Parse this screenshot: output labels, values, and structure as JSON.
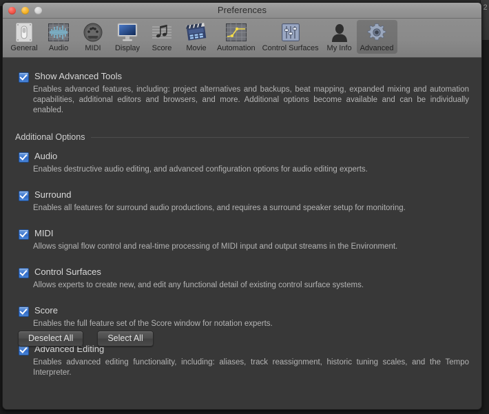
{
  "background": {
    "right_window_label": "2"
  },
  "window": {
    "title": "Preferences",
    "traffic_lights": [
      {
        "name": "close-button",
        "color": "#f45b4f"
      },
      {
        "name": "minimize-button",
        "color": "#f7b731"
      },
      {
        "name": "zoom-button",
        "color": "#d2d2d2"
      }
    ]
  },
  "toolbar": {
    "items": [
      {
        "label": "General",
        "icon": "toggle-switch-icon",
        "selected": false
      },
      {
        "label": "Audio",
        "icon": "waveform-icon",
        "selected": false
      },
      {
        "label": "MIDI",
        "icon": "midi-port-icon",
        "selected": false
      },
      {
        "label": "Display",
        "icon": "monitor-icon",
        "selected": false
      },
      {
        "label": "Score",
        "icon": "music-notes-icon",
        "selected": false
      },
      {
        "label": "Movie",
        "icon": "clapperboard-icon",
        "selected": false
      },
      {
        "label": "Automation",
        "icon": "automation-curve-icon",
        "selected": false
      },
      {
        "label": "Control Surfaces",
        "icon": "faders-icon",
        "selected": false
      },
      {
        "label": "My Info",
        "icon": "person-icon",
        "selected": false
      },
      {
        "label": "Advanced",
        "icon": "gear-icon",
        "selected": true
      }
    ]
  },
  "main": {
    "show_advanced_tools": {
      "label": "Show Advanced Tools",
      "checked": true,
      "description": "Enables advanced features, including: project alternatives and backups, beat mapping, expanded mixing and automation capabilities, additional editors and browsers, and more. Additional options become available and can be individually enabled."
    },
    "section_title": "Additional Options",
    "options": [
      {
        "label": "Audio",
        "checked": true,
        "description": "Enables destructive audio editing, and advanced configuration options for audio editing experts."
      },
      {
        "label": "Surround",
        "checked": true,
        "description": "Enables all features for surround audio productions, and requires a surround speaker setup for monitoring."
      },
      {
        "label": "MIDI",
        "checked": true,
        "description": "Allows signal flow control and real-time processing of MIDI input and output streams in the Environment."
      },
      {
        "label": "Control Surfaces",
        "checked": true,
        "description": "Allows experts to create new, and edit any functional detail of existing control surface systems."
      },
      {
        "label": "Score",
        "checked": true,
        "description": "Enables the full feature set of the Score window for notation experts."
      },
      {
        "label": "Advanced Editing",
        "checked": true,
        "description": "Enables advanced editing functionality, including: aliases, track reassignment, historic tuning scales, and the Tempo Interpreter."
      }
    ],
    "buttons": {
      "deselect_all": "Deselect All",
      "select_all": "Select All"
    }
  },
  "colors": {
    "window_background": "#383838",
    "titlebar": "#949494",
    "toolbar": "#8a8a8a",
    "checkbox_accent": "#3f78cf",
    "text_primary": "#d8d8d8",
    "text_secondary": "#b4b4b4"
  }
}
